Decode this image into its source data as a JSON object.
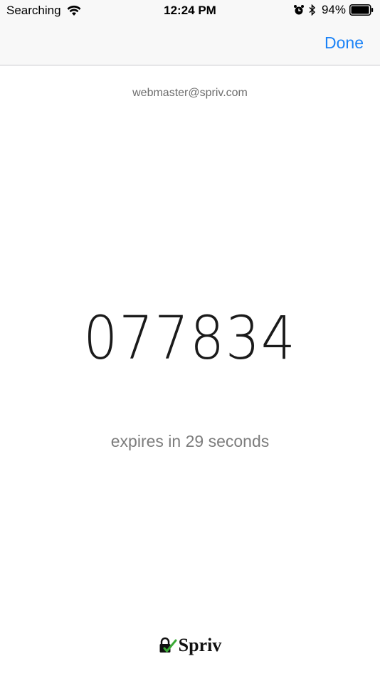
{
  "status_bar": {
    "carrier": "Searching",
    "time": "12:24 PM",
    "battery_percent": "94%",
    "icons": [
      "wifi-icon",
      "alarm-icon",
      "bluetooth-icon",
      "battery-icon"
    ]
  },
  "nav": {
    "done_label": "Done"
  },
  "account": {
    "email": "webmaster@spriv.com"
  },
  "token": {
    "code": "077834",
    "expiry_text": "expires in 29 seconds"
  },
  "brand": {
    "name": "Spriv",
    "check_color": "#3aa935"
  },
  "colors": {
    "accent": "#1a82f7"
  }
}
